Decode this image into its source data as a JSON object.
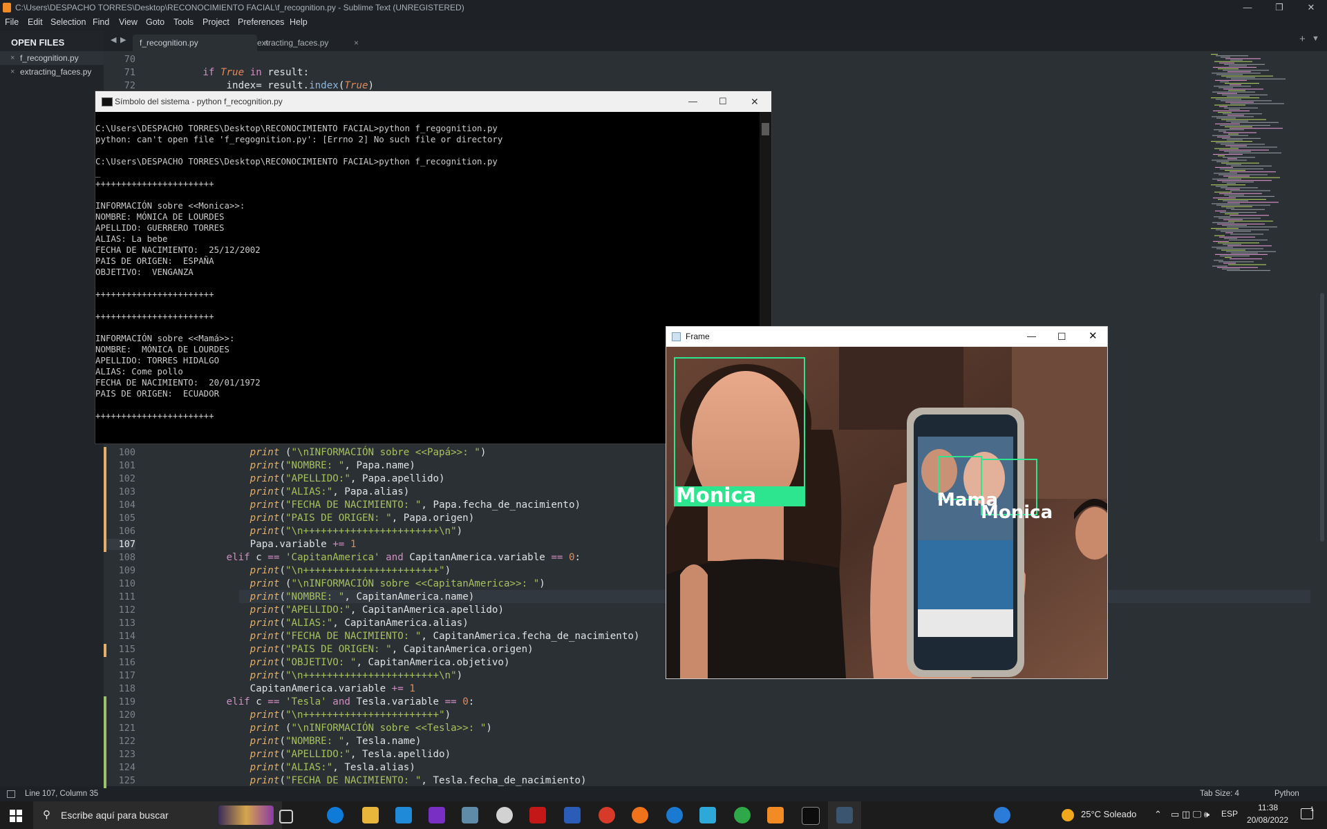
{
  "titlebar": {
    "title": "C:\\Users\\DESPACHO TORRES\\Desktop\\RECONOCIMIENTO FACIAL\\f_recognition.py - Sublime Text (UNREGISTERED)",
    "minimize": "—",
    "maximize": "❐",
    "close": "✕"
  },
  "menu": [
    "File",
    "Edit",
    "Selection",
    "Find",
    "View",
    "Goto",
    "Tools",
    "Project",
    "Preferences",
    "Help"
  ],
  "sidebar": {
    "header": "OPEN FILES",
    "items": [
      {
        "label": "f_recognition.py",
        "close": "×"
      },
      {
        "label": "extracting_faces.py",
        "close": "×"
      }
    ]
  },
  "tabs": [
    {
      "label": "f_recognition.py",
      "close": "×"
    },
    {
      "label": "extracting_faces.py",
      "close": "×"
    }
  ],
  "tab_nav": {
    "prev": "◀",
    "next": "▶",
    "new": "+",
    "more": "▼"
  },
  "editor_top": [
    {
      "ln": "70",
      "code": ""
    },
    {
      "ln": "71",
      "code_parts": [
        [
          "",
          "        "
        ],
        [
          "kw",
          "if "
        ],
        [
          "cn",
          "True "
        ],
        [
          "kw",
          "in"
        ],
        [
          "",
          " result:"
        ]
      ]
    },
    {
      "ln": "72",
      "code_parts": [
        [
          "",
          "            index= result."
        ],
        [
          "pl",
          "index"
        ],
        [
          "",
          "("
        ],
        [
          "cn",
          "True"
        ],
        [
          "",
          ")"
        ]
      ]
    }
  ],
  "editor_lines": [
    {
      "ln": "100",
      "code_parts": [
        [
          "",
          "                "
        ],
        [
          "fn",
          "print"
        ],
        [
          "",
          " ("
        ],
        [
          "st",
          "\"\\nINFORMACIÓN sobre <<Papá>>: \""
        ],
        [
          "",
          ")"
        ]
      ]
    },
    {
      "ln": "101",
      "code_parts": [
        [
          "",
          "                "
        ],
        [
          "fn",
          "print"
        ],
        [
          "",
          "("
        ],
        [
          "st",
          "\"NOMBRE: \""
        ],
        [
          "",
          ", Papa.name)"
        ]
      ]
    },
    {
      "ln": "102",
      "code_parts": [
        [
          "",
          "                "
        ],
        [
          "fn",
          "print"
        ],
        [
          "",
          "("
        ],
        [
          "st",
          "\"APELLIDO:\""
        ],
        [
          "",
          ", Papa.apellido)"
        ]
      ]
    },
    {
      "ln": "103",
      "code_parts": [
        [
          "",
          "                "
        ],
        [
          "fn",
          "print"
        ],
        [
          "",
          "("
        ],
        [
          "st",
          "\"ALIAS:\""
        ],
        [
          "",
          ", Papa.alias)"
        ]
      ]
    },
    {
      "ln": "104",
      "code_parts": [
        [
          "",
          "                "
        ],
        [
          "fn",
          "print"
        ],
        [
          "",
          "("
        ],
        [
          "st",
          "\"FECHA DE NACIMIENTO: \""
        ],
        [
          "",
          ", Papa.fecha_de_nacimiento)"
        ]
      ]
    },
    {
      "ln": "105",
      "code_parts": [
        [
          "",
          "                "
        ],
        [
          "fn",
          "print"
        ],
        [
          "",
          "("
        ],
        [
          "st",
          "\"PAIS DE ORIGEN: \""
        ],
        [
          "",
          ", Papa.origen)"
        ]
      ]
    },
    {
      "ln": "106",
      "code_parts": [
        [
          "",
          "                "
        ],
        [
          "fn",
          "print"
        ],
        [
          "",
          "("
        ],
        [
          "st",
          "\"\\n+++++++++++++++++++++++\\n\""
        ],
        [
          "",
          ")"
        ]
      ]
    },
    {
      "ln": "107",
      "code_parts": [
        [
          "",
          "                Papa.variable "
        ],
        [
          "kw",
          "+="
        ],
        [
          "",
          " "
        ],
        [
          "nm",
          "1"
        ]
      ]
    },
    {
      "ln": "108",
      "code_parts": [
        [
          "",
          "            "
        ],
        [
          "kw",
          "elif"
        ],
        [
          "",
          " c "
        ],
        [
          "kw",
          "=="
        ],
        [
          "",
          " "
        ],
        [
          "st",
          "'CapitanAmerica'"
        ],
        [
          "",
          " "
        ],
        [
          "kw",
          "and"
        ],
        [
          "",
          " CapitanAmerica.variable "
        ],
        [
          "kw",
          "=="
        ],
        [
          "",
          " "
        ],
        [
          "nm",
          "0"
        ],
        [
          "",
          ":"
        ]
      ]
    },
    {
      "ln": "109",
      "code_parts": [
        [
          "",
          "                "
        ],
        [
          "fn",
          "print"
        ],
        [
          "",
          "("
        ],
        [
          "st",
          "\"\\n+++++++++++++++++++++++\""
        ],
        [
          "",
          ")"
        ]
      ]
    },
    {
      "ln": "110",
      "code_parts": [
        [
          "",
          "                "
        ],
        [
          "fn",
          "print"
        ],
        [
          "",
          " ("
        ],
        [
          "st",
          "\"\\nINFORMACIÓN sobre <<CapitanAmerica>>: \""
        ],
        [
          "",
          ")"
        ]
      ]
    },
    {
      "ln": "111",
      "code_parts": [
        [
          "",
          "                "
        ],
        [
          "fn",
          "print"
        ],
        [
          "",
          "("
        ],
        [
          "st",
          "\"NOMBRE: \""
        ],
        [
          "",
          ", CapitanAmerica.name)"
        ]
      ]
    },
    {
      "ln": "112",
      "code_parts": [
        [
          "",
          "                "
        ],
        [
          "fn",
          "print"
        ],
        [
          "",
          "("
        ],
        [
          "st",
          "\"APELLIDO:\""
        ],
        [
          "",
          ", CapitanAmerica.apellido)"
        ]
      ]
    },
    {
      "ln": "113",
      "code_parts": [
        [
          "",
          "                "
        ],
        [
          "fn",
          "print"
        ],
        [
          "",
          "("
        ],
        [
          "st",
          "\"ALIAS:\""
        ],
        [
          "",
          ", CapitanAmerica.alias)"
        ]
      ]
    },
    {
      "ln": "114",
      "code_parts": [
        [
          "",
          "                "
        ],
        [
          "fn",
          "print"
        ],
        [
          "",
          "("
        ],
        [
          "st",
          "\"FECHA DE NACIMIENTO: \""
        ],
        [
          "",
          ", CapitanAmerica.fecha_de_nacimiento)"
        ]
      ]
    },
    {
      "ln": "115",
      "code_parts": [
        [
          "",
          "                "
        ],
        [
          "fn",
          "print"
        ],
        [
          "",
          "("
        ],
        [
          "st",
          "\"PAIS DE ORIGEN: \""
        ],
        [
          "",
          ", CapitanAmerica.origen)"
        ]
      ]
    },
    {
      "ln": "116",
      "code_parts": [
        [
          "",
          "                "
        ],
        [
          "fn",
          "print"
        ],
        [
          "",
          "("
        ],
        [
          "st",
          "\"OBJETIVO: \""
        ],
        [
          "",
          ", CapitanAmerica.objetivo)"
        ]
      ]
    },
    {
      "ln": "117",
      "code_parts": [
        [
          "",
          "                "
        ],
        [
          "fn",
          "print"
        ],
        [
          "",
          "("
        ],
        [
          "st",
          "\"\\n+++++++++++++++++++++++\\n\""
        ],
        [
          "",
          ")"
        ]
      ]
    },
    {
      "ln": "118",
      "code_parts": [
        [
          "",
          "                CapitanAmerica.variable "
        ],
        [
          "kw",
          "+="
        ],
        [
          "",
          " "
        ],
        [
          "nm",
          "1"
        ]
      ]
    },
    {
      "ln": "119",
      "code_parts": [
        [
          "",
          "            "
        ],
        [
          "kw",
          "elif"
        ],
        [
          "",
          " c "
        ],
        [
          "kw",
          "=="
        ],
        [
          "",
          " "
        ],
        [
          "st",
          "'Tesla'"
        ],
        [
          "",
          " "
        ],
        [
          "kw",
          "and"
        ],
        [
          "",
          " Tesla.variable "
        ],
        [
          "kw",
          "=="
        ],
        [
          "",
          " "
        ],
        [
          "nm",
          "0"
        ],
        [
          "",
          ":"
        ]
      ]
    },
    {
      "ln": "120",
      "code_parts": [
        [
          "",
          "                "
        ],
        [
          "fn",
          "print"
        ],
        [
          "",
          "("
        ],
        [
          "st",
          "\"\\n+++++++++++++++++++++++\""
        ],
        [
          "",
          ")"
        ]
      ]
    },
    {
      "ln": "121",
      "code_parts": [
        [
          "",
          "                "
        ],
        [
          "fn",
          "print"
        ],
        [
          "",
          " ("
        ],
        [
          "st",
          "\"\\nINFORMACIÓN sobre <<Tesla>>: \""
        ],
        [
          "",
          ")"
        ]
      ]
    },
    {
      "ln": "122",
      "code_parts": [
        [
          "",
          "                "
        ],
        [
          "fn",
          "print"
        ],
        [
          "",
          "("
        ],
        [
          "st",
          "\"NOMBRE: \""
        ],
        [
          "",
          ", Tesla.name)"
        ]
      ]
    },
    {
      "ln": "123",
      "code_parts": [
        [
          "",
          "                "
        ],
        [
          "fn",
          "print"
        ],
        [
          "",
          "("
        ],
        [
          "st",
          "\"APELLIDO:\""
        ],
        [
          "",
          ", Tesla.apellido)"
        ]
      ]
    },
    {
      "ln": "124",
      "code_parts": [
        [
          "",
          "                "
        ],
        [
          "fn",
          "print"
        ],
        [
          "",
          "("
        ],
        [
          "st",
          "\"ALIAS:\""
        ],
        [
          "",
          ", Tesla.alias)"
        ]
      ]
    },
    {
      "ln": "125",
      "code_parts": [
        [
          "",
          "                "
        ],
        [
          "fn",
          "print"
        ],
        [
          "",
          "("
        ],
        [
          "st",
          "\"FECHA DE NACIMIENTO: \""
        ],
        [
          "",
          ", Tesla.fecha_de_nacimiento)"
        ]
      ]
    }
  ],
  "statusbar": {
    "position": "Line 107, Column 35",
    "tab_size": "Tab Size: 4",
    "syntax": "Python"
  },
  "cmd": {
    "title": "Símbolo del sistema - python  f_recognition.py",
    "lines": [
      "",
      "C:\\Users\\DESPACHO TORRES\\Desktop\\RECONOCIMIENTO FACIAL>python f_regognition.py",
      "python: can't open file 'f_regognition.py': [Errno 2] No such file or directory",
      "",
      "C:\\Users\\DESPACHO TORRES\\Desktop\\RECONOCIMIENTO FACIAL>python f_recognition.py",
      "_",
      "+++++++++++++++++++++++",
      "",
      "INFORMACIÓN sobre <<Monica>>:",
      "NOMBRE: MÓNICA DE LOURDES",
      "APELLIDO: GUERRERO TORRES",
      "ALIAS: La bebe",
      "FECHA DE NACIMIENTO:  25/12/2002",
      "PAIS DE ORIGEN:  ESPAÑA",
      "OBJETIVO:  VENGANZA",
      "",
      "+++++++++++++++++++++++",
      "",
      "+++++++++++++++++++++++",
      "",
      "INFORMACIÓN sobre <<Mamá>>:",
      "NOMBRE:  MÓNICA DE LOURDES",
      "APELLIDO: TORRES HIDALGO",
      "ALIAS: Come pollo",
      "FECHA DE NACIMIENTO:  20/01/1972",
      "PAIS DE ORIGEN:  ECUADOR",
      "",
      "+++++++++++++++++++++++"
    ]
  },
  "frame": {
    "title": "Frame",
    "labels": [
      "Monica",
      "Mama",
      "Monica"
    ]
  },
  "taskbar": {
    "search_placeholder": "Escribe aquí para buscar",
    "weather": "25°C  Soleado",
    "lang": "ESP",
    "time": "11:38",
    "date": "20/08/2022",
    "notif_count": "1"
  },
  "colors": {
    "editor_bg": "#2b3035",
    "detect_box": "#2ee58f",
    "sublime_accent": "#f28b24"
  }
}
